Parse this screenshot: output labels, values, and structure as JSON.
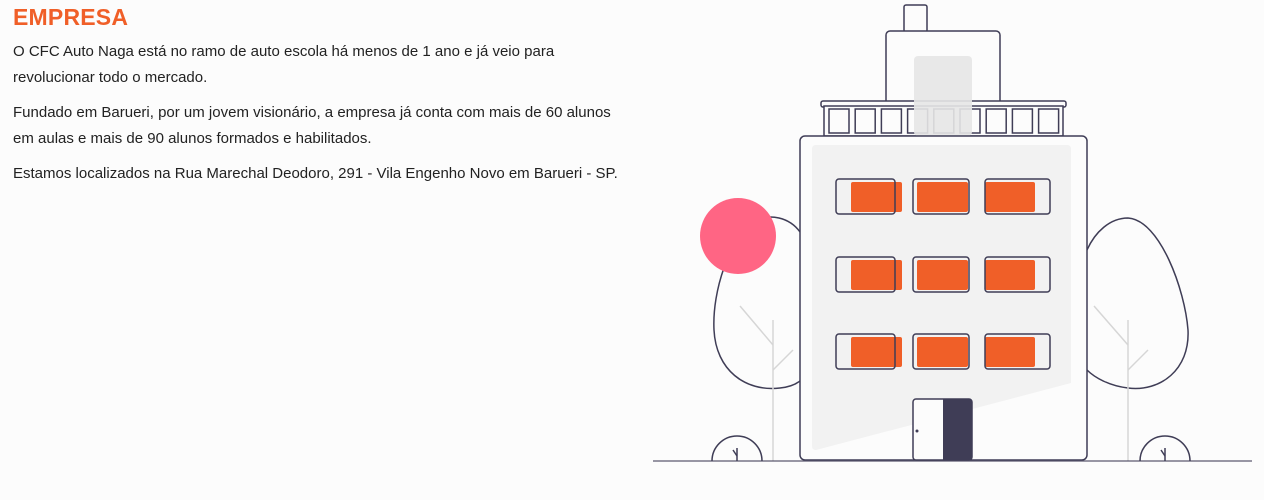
{
  "section": {
    "title": "EMPRESA",
    "paragraphs": [
      "O CFC Auto Naga está no ramo de auto escola há menos de 1 ano e já veio para revolucionar todo o mercado.",
      "Fundado em Barueri, por um jovem visionário, a empresa já conta com mais de 60 alunos em aulas e mais de 90 alunos formados e habilitados.",
      "Estamos localizados na Rua Marechal Deodoro, 291 - Vila Engenho Novo em Barueri - SP."
    ]
  },
  "colors": {
    "accent": "#f05f28",
    "pink": "#ff6584",
    "ink": "#3f3d56"
  }
}
